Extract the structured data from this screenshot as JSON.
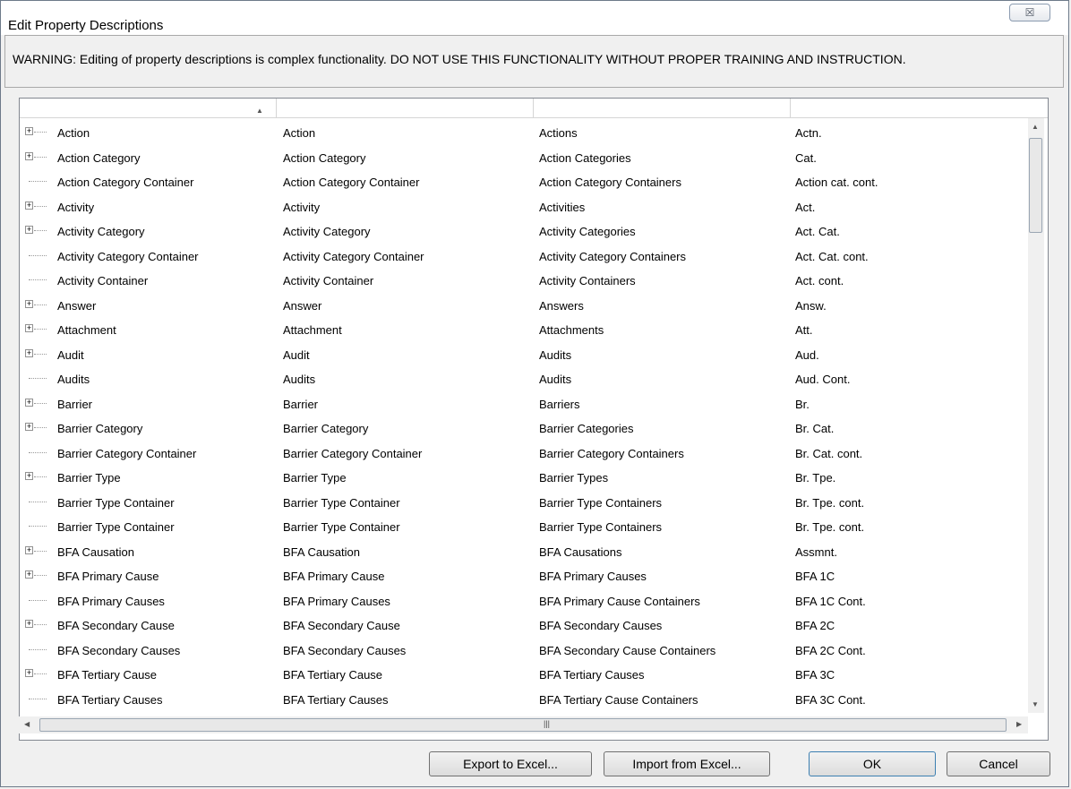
{
  "window": {
    "title": "Edit Property Descriptions",
    "close_glyph": "☒"
  },
  "warning": "WARNING: Editing of property descriptions is complex functionality. DO NOT USE THIS FUNCTIONALITY WITHOUT PROPER TRAINING AND INSTRUCTION.",
  "grid": {
    "rows": [
      {
        "expand": true,
        "name": "Action",
        "singular": "Action",
        "plural": "Actions",
        "abbr": "Actn."
      },
      {
        "expand": true,
        "name": "Action Category",
        "singular": "Action Category",
        "plural": "Action Categories",
        "abbr": "Cat."
      },
      {
        "expand": false,
        "name": "Action Category Container",
        "singular": "Action Category Container",
        "plural": "Action Category Containers",
        "abbr": "Action cat. cont."
      },
      {
        "expand": true,
        "name": "Activity",
        "singular": "Activity",
        "plural": "Activities",
        "abbr": "Act."
      },
      {
        "expand": true,
        "name": "Activity Category",
        "singular": "Activity Category",
        "plural": "Activity Categories",
        "abbr": "Act. Cat."
      },
      {
        "expand": false,
        "name": "Activity Category Container",
        "singular": "Activity Category Container",
        "plural": "Activity Category Containers",
        "abbr": "Act. Cat. cont."
      },
      {
        "expand": false,
        "name": "Activity Container",
        "singular": "Activity Container",
        "plural": "Activity Containers",
        "abbr": "Act. cont."
      },
      {
        "expand": true,
        "name": "Answer",
        "singular": "Answer",
        "plural": "Answers",
        "abbr": "Answ."
      },
      {
        "expand": true,
        "name": "Attachment",
        "singular": "Attachment",
        "plural": "Attachments",
        "abbr": "Att."
      },
      {
        "expand": true,
        "name": "Audit",
        "singular": "Audit",
        "plural": "Audits",
        "abbr": "Aud."
      },
      {
        "expand": false,
        "name": "Audits",
        "singular": "Audits",
        "plural": "Audits",
        "abbr": "Aud. Cont."
      },
      {
        "expand": true,
        "name": "Barrier",
        "singular": "Barrier",
        "plural": "Barriers",
        "abbr": "Br."
      },
      {
        "expand": true,
        "name": "Barrier Category",
        "singular": "Barrier Category",
        "plural": "Barrier Categories",
        "abbr": "Br. Cat."
      },
      {
        "expand": false,
        "name": "Barrier Category Container",
        "singular": "Barrier Category Container",
        "plural": "Barrier Category Containers",
        "abbr": "Br. Cat. cont."
      },
      {
        "expand": true,
        "name": "Barrier Type",
        "singular": "Barrier Type",
        "plural": "Barrier Types",
        "abbr": "Br. Tpe."
      },
      {
        "expand": false,
        "name": "Barrier Type Container",
        "singular": "Barrier Type Container",
        "plural": "Barrier Type Containers",
        "abbr": "Br. Tpe. cont."
      },
      {
        "expand": false,
        "name": "Barrier Type Container",
        "singular": "Barrier Type Container",
        "plural": "Barrier Type Containers",
        "abbr": "Br. Tpe. cont."
      },
      {
        "expand": true,
        "name": "BFA Causation",
        "singular": "BFA Causation",
        "plural": "BFA Causations",
        "abbr": "Assmnt."
      },
      {
        "expand": true,
        "name": "BFA Primary Cause",
        "singular": "BFA Primary Cause",
        "plural": "BFA Primary Causes",
        "abbr": "BFA 1C"
      },
      {
        "expand": false,
        "name": "BFA Primary Causes",
        "singular": "BFA Primary Causes",
        "plural": "BFA Primary Cause Containers",
        "abbr": "BFA 1C Cont."
      },
      {
        "expand": true,
        "name": "BFA Secondary Cause",
        "singular": "BFA Secondary Cause",
        "plural": "BFA Secondary Causes",
        "abbr": "BFA 2C"
      },
      {
        "expand": false,
        "name": "BFA Secondary Causes",
        "singular": "BFA Secondary Causes",
        "plural": "BFA Secondary Cause Containers",
        "abbr": "BFA 2C Cont."
      },
      {
        "expand": true,
        "name": "BFA Tertiary Cause",
        "singular": "BFA Tertiary Cause",
        "plural": "BFA Tertiary Causes",
        "abbr": "BFA 3C"
      },
      {
        "expand": false,
        "name": "BFA Tertiary Causes",
        "singular": "BFA Tertiary Causes",
        "plural": "BFA Tertiary Cause Containers",
        "abbr": "BFA 3C Cont."
      }
    ]
  },
  "buttons": {
    "export": "Export to Excel...",
    "import": "Import from Excel...",
    "ok": "OK",
    "cancel": "Cancel"
  },
  "icons": {
    "expand": "plus-box-icon",
    "sort": "sort-ascending-icon"
  },
  "colors": {
    "window_bg": "#f0f0f0",
    "grid_bg": "#ffffff",
    "default_button_border": "#3c7fb1"
  }
}
